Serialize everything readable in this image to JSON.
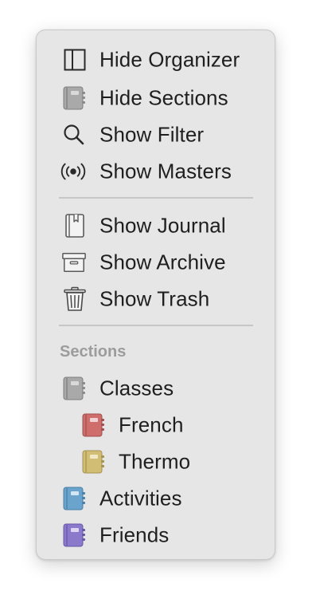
{
  "menu": {
    "items": [
      {
        "label": "Hide Organizer",
        "icon": "sidebar-icon"
      },
      {
        "label": "Hide Sections",
        "icon": "notebook-icon"
      },
      {
        "label": "Show Filter",
        "icon": "magnifier-icon"
      },
      {
        "label": "Show Masters",
        "icon": "broadcast-icon"
      },
      {
        "label": "Show Journal",
        "icon": "journal-icon"
      },
      {
        "label": "Show Archive",
        "icon": "archive-box-icon"
      },
      {
        "label": "Show Trash",
        "icon": "trash-icon"
      }
    ],
    "sections_header": "Sections",
    "sections": [
      {
        "label": "Classes",
        "icon": "notebook-icon",
        "color": "#a9a9a9"
      },
      {
        "label": "French",
        "icon": "notebook-icon",
        "color": "#cf6d6d"
      },
      {
        "label": "Thermo",
        "icon": "notebook-icon",
        "color": "#d1bd73"
      },
      {
        "label": "Activities",
        "icon": "notebook-icon",
        "color": "#6aa3cc"
      },
      {
        "label": "Friends",
        "icon": "notebook-icon",
        "color": "#8b7acb"
      }
    ]
  }
}
